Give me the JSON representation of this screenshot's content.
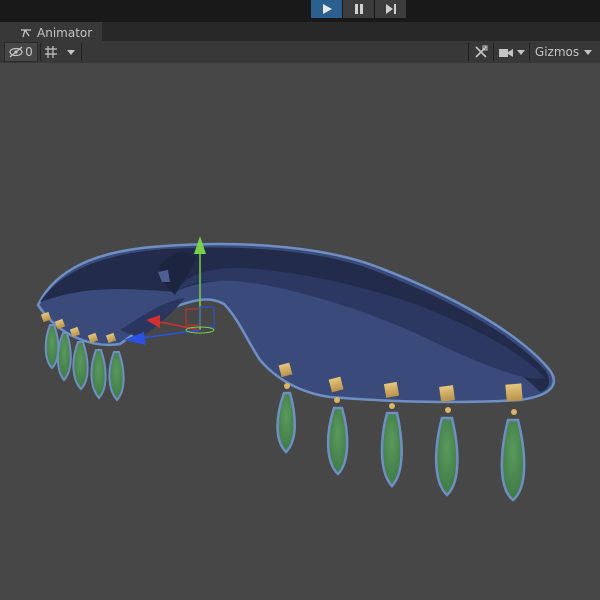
{
  "play_controls": {
    "play": "play-icon",
    "pause": "pause-icon",
    "step": "step-icon",
    "accent": "#2a5f8f"
  },
  "window": {
    "tab_label": "Animator",
    "tab_icon": "animator-icon"
  },
  "toolbar": {
    "hidden_count": "0",
    "gizmos_label": "Gizmos"
  },
  "colors": {
    "background": "#474747",
    "whale_body": "#3a4a7a",
    "whale_dark": "#222b4a",
    "outline": "#6e8fc4",
    "tentacle": "#4c8a52",
    "mount": "#d9b46a",
    "gizmo_x": "#d03030",
    "gizmo_y": "#7ad048",
    "gizmo_z": "#2a52e0"
  }
}
